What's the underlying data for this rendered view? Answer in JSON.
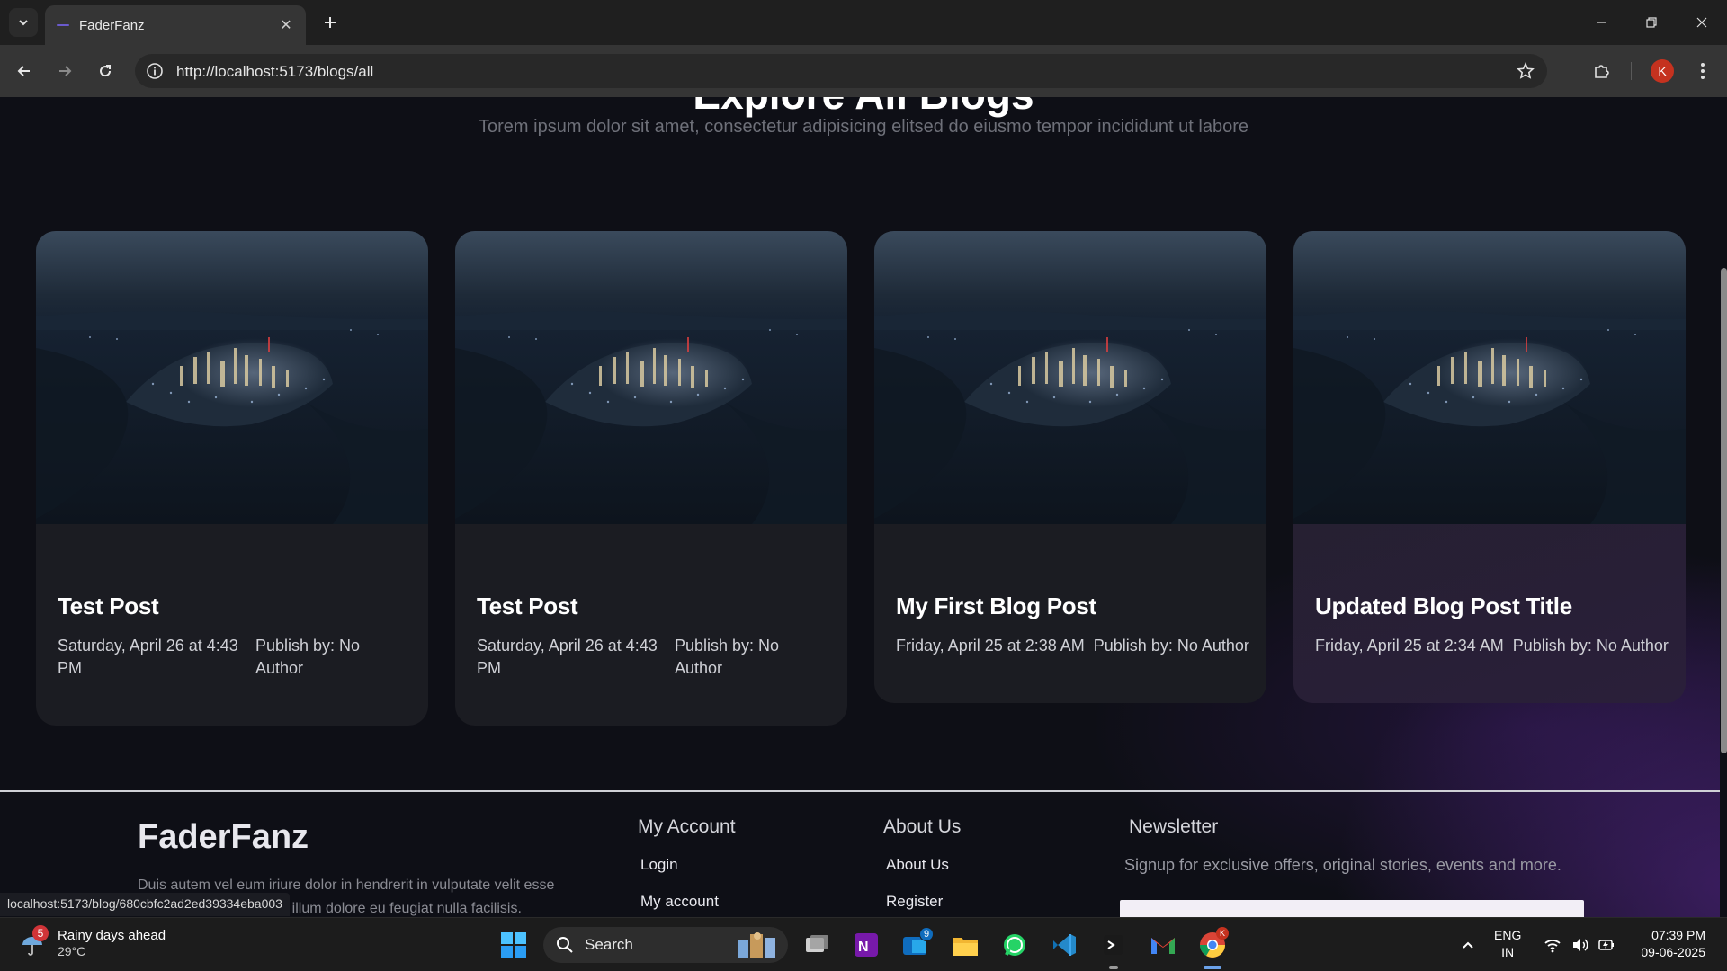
{
  "browser": {
    "tab_title": "FaderFanz",
    "url": "http://localhost:5173/blogs/all",
    "profile_initial": "K",
    "status_url": "localhost:5173/blog/680cbfc2ad2ed39334eba003"
  },
  "page": {
    "heading": "Explore All Blogs",
    "subtitle": "Torem ipsum dolor sit amet, consectetur adipisicing elitsed do eiusmo tempor incididunt ut labore"
  },
  "blogs": [
    {
      "title": "Test Post",
      "date": "Saturday, April 26 at 4:43 PM",
      "author": "Publish by: No Author"
    },
    {
      "title": "Test Post",
      "date": "Saturday, April 26 at 4:43 PM",
      "author": "Publish by: No Author"
    },
    {
      "title": "My First Blog Post",
      "date": "Friday, April 25 at 2:38 AM",
      "author": "Publish by: No Author"
    },
    {
      "title": "Updated Blog Post Title",
      "date": "Friday, April 25 at 2:34 AM",
      "author": "Publish by: No Author"
    }
  ],
  "footer": {
    "brand": "FaderFanz",
    "description": "Duis autem vel eum iriure dolor in hendrerit in vulputate velit esse molestie consequat, vel illum dolore eu feugiat nulla facilisis.",
    "my_account": {
      "title": "My Account",
      "links": [
        "Login",
        "My account"
      ]
    },
    "about_us": {
      "title": "About Us",
      "links": [
        "About Us",
        "Register"
      ]
    },
    "newsletter": {
      "title": "Newsletter",
      "text": "Signup for exclusive offers, original stories, events and more."
    }
  },
  "taskbar": {
    "weather_title": "Rainy days ahead",
    "weather_temp": "29°C",
    "weather_badge": "5",
    "search_label": "Search",
    "outlook_badge": "9",
    "lang_top": "ENG",
    "lang_bottom": "IN",
    "time": "07:39 PM",
    "date": "09-06-2025"
  }
}
